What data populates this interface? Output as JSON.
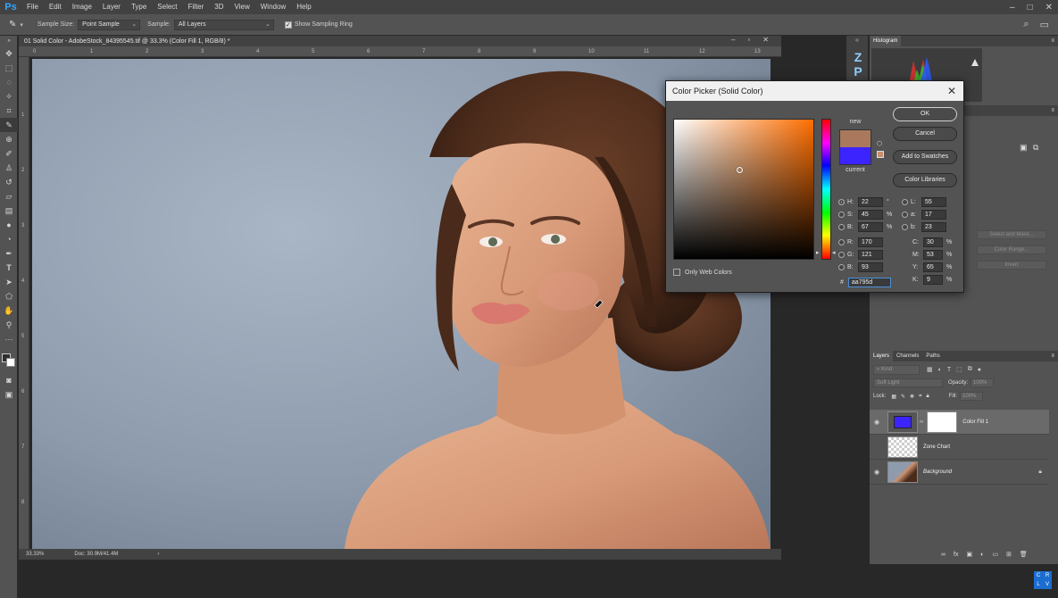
{
  "app": {
    "logo": "Ps"
  },
  "menu": [
    "File",
    "Edit",
    "Image",
    "Layer",
    "Type",
    "Select",
    "Filter",
    "3D",
    "View",
    "Window",
    "Help"
  ],
  "options_bar": {
    "sample_size_label": "Sample Size:",
    "sample_size_value": "Point Sample",
    "sample_label": "Sample:",
    "sample_value": "All Layers",
    "show_ring_label": "Show Sampling Ring",
    "show_ring_checked": true
  },
  "document": {
    "tab_title": "01 Solid Color - AdobeStock_84395545.tif @ 33.3% (Color Fill 1, RGB/8) *",
    "zoom": "33.33%",
    "doc_info": "Doc: 30.9M/41.4M",
    "ruler_top": [
      "0",
      "1",
      "2",
      "3",
      "4",
      "5",
      "6",
      "7",
      "8",
      "9",
      "10",
      "11",
      "12",
      "13"
    ],
    "ruler_left": [
      "1",
      "2",
      "3",
      "4",
      "5",
      "6",
      "7",
      "8"
    ]
  },
  "color_picker": {
    "title": "Color Picker (Solid Color)",
    "ok_label": "OK",
    "cancel_label": "Cancel",
    "add_swatches_label": "Add to Swatches",
    "color_libraries_label": "Color Libraries",
    "new_label": "new",
    "current_label": "current",
    "new_color": "#aa795d",
    "current_color": "#3c24ff",
    "only_web_colors_label": "Only Web Colors",
    "hsb": {
      "H": "22",
      "S": "45",
      "B": "67"
    },
    "rgb": {
      "R": "170",
      "G": "121",
      "B": "93"
    },
    "lab": {
      "L": "55",
      "a": "17",
      "b": "23"
    },
    "cmyk": {
      "C": "30",
      "M": "53",
      "Y": "65",
      "K": "9"
    },
    "hex": "aa795d",
    "units": {
      "degree": "°",
      "percent": "%"
    }
  },
  "panels": {
    "histogram_tab": "Histogram",
    "layer_tabs": [
      "Layers",
      "Channels",
      "Paths"
    ],
    "kind_placeholder": "Kind",
    "blend_mode": "Soft Light",
    "opacity_label": "Opacity:",
    "opacity_value": "100%",
    "lock_label": "Lock:",
    "fill_label": "Fill:",
    "fill_value": "100%",
    "ghost_buttons": [
      "Select and Mask...",
      "Color Range...",
      "Invert"
    ],
    "layers": [
      {
        "name": "Color Fill 1",
        "visible": true,
        "selected": true
      },
      {
        "name": "Zone Chart",
        "visible": false,
        "selected": false
      },
      {
        "name": "Background",
        "visible": true,
        "selected": false,
        "locked": true
      }
    ]
  },
  "colors": {
    "accent": "#31a8ff",
    "swatch_new": "#aa795d",
    "swatch_current": "#3c24ff"
  }
}
